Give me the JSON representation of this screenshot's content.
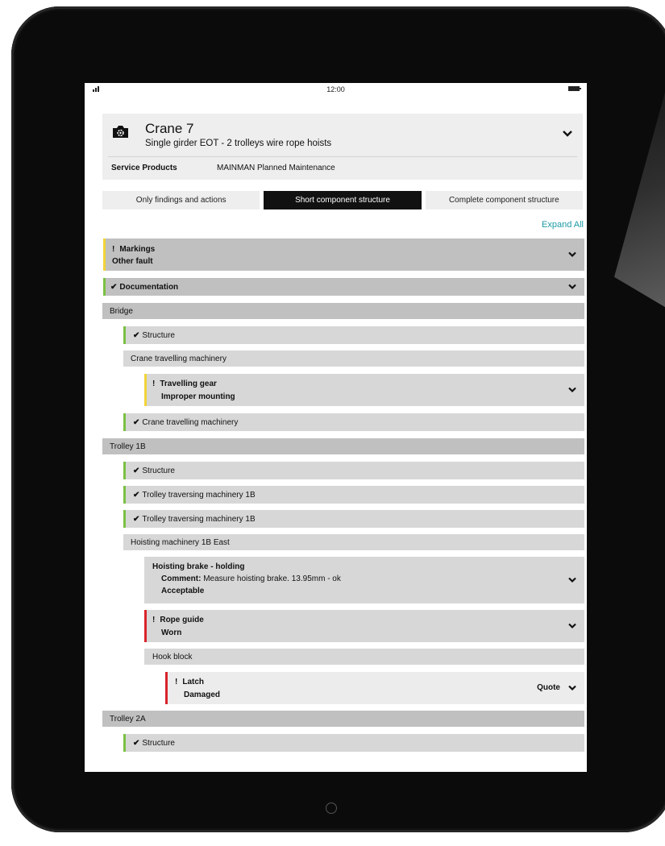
{
  "colors": {
    "accent": "#1d9aa6",
    "ok": "#7ac143",
    "warning": "#f2d33b",
    "critical": "#d9232a",
    "active_tab": "#111111"
  },
  "status_bar": {
    "time": "12:00",
    "signal_icon": "signal-icon",
    "battery_icon": "battery-icon"
  },
  "asset": {
    "icon": "camera-gear-icon",
    "title": "Crane 7",
    "subtitle": "Single girder EOT - 2 trolleys wire rope hoists",
    "service_label": "Service Products",
    "service_value": "MAINMAN Planned Maintenance"
  },
  "filter_tabs": [
    {
      "label": "Only findings and actions",
      "active": false
    },
    {
      "label": "Short component structure",
      "active": true
    },
    {
      "label": "Complete component structure",
      "active": false
    }
  ],
  "expand_all": "Expand All",
  "tree": [
    {
      "status": "warning",
      "title": "Markings",
      "detail": "Other fault",
      "expandable": true
    },
    {
      "status": "ok",
      "title": "Documentation",
      "expandable": true
    },
    {
      "group": "Bridge"
    },
    {
      "status": "ok",
      "title": "Structure"
    },
    {
      "group": "Crane travelling machinery"
    },
    {
      "status": "warning",
      "title": "Travelling gear",
      "detail": "Improper mounting",
      "expandable": true
    },
    {
      "status": "ok",
      "title": "Crane travelling machinery"
    },
    {
      "group": "Trolley 1B"
    },
    {
      "status": "ok",
      "title": "Structure"
    },
    {
      "status": "ok",
      "title": "Trolley traversing machinery 1B"
    },
    {
      "status": "ok",
      "title": "Trolley traversing machinery 1B"
    },
    {
      "group": "Hoisting machinery 1B East"
    },
    {
      "title": "Hoisting brake - holding",
      "comment_label": "Comment:",
      "comment": " Measure hoisting brake. 13.95mm - ok",
      "result": "Acceptable",
      "expandable": true
    },
    {
      "status": "critical",
      "title": "Rope guide",
      "detail": "Worn",
      "expandable": true
    },
    {
      "group": "Hook block"
    },
    {
      "status": "critical",
      "title": "Latch",
      "detail": "Damaged",
      "action": "Quote",
      "expandable": true
    },
    {
      "group": "Trolley 2A"
    },
    {
      "status": "ok",
      "title": "Structure"
    }
  ]
}
